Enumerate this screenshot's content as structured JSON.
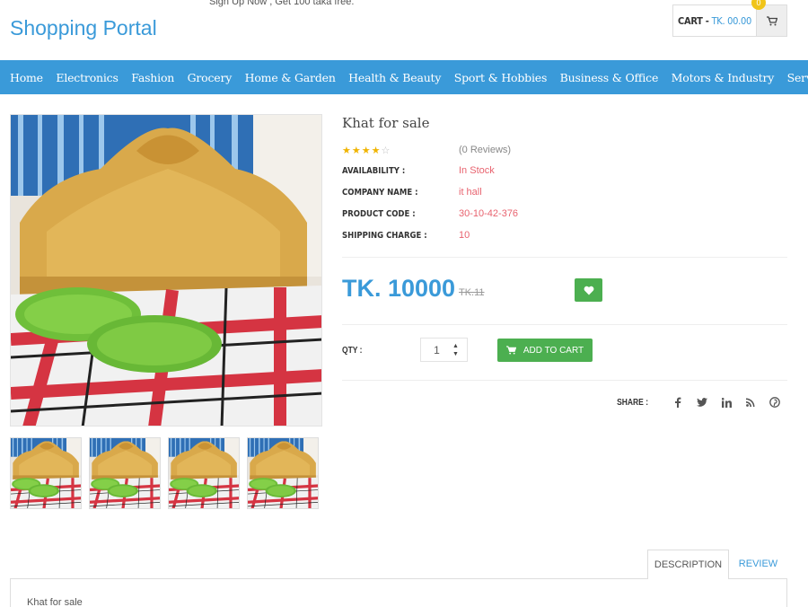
{
  "header": {
    "signup_note": "Sign Up Now , Get 100 taka free.",
    "logo": "Shopping Portal",
    "cart_label": "CART -",
    "cart_amount": "TK. 00.00",
    "cart_count": "0"
  },
  "nav": {
    "items": [
      "Home",
      "Electronics",
      "Fashion",
      "Grocery",
      "Home & Garden",
      "Health & Beauty",
      "Sport & Hobbies",
      "Business & Office",
      "Motors & Industry",
      "Services"
    ]
  },
  "product": {
    "title": "Khat for sale",
    "rating": 4,
    "rating_max": 5,
    "reviews": "(0 Reviews)",
    "specs": [
      {
        "label": "AVAILABILITY :",
        "value": "In Stock"
      },
      {
        "label": "COMPANY NAME :",
        "value": "it hall"
      },
      {
        "label": "PRODUCT CODE :",
        "value": "30-10-42-376"
      },
      {
        "label": "SHIPPING CHARGE :",
        "value": "10"
      }
    ],
    "price": "TK. 10000",
    "old_price": "TK.11",
    "qty_label": "QTY :",
    "qty_value": "1",
    "add_to_cart": "ADD TO CART",
    "share_label": "SHARE :",
    "share_icons": [
      "facebook-icon",
      "twitter-icon",
      "linkedin-icon",
      "rss-icon",
      "pinterest-icon"
    ]
  },
  "tabs": {
    "description": "DESCRIPTION",
    "review": "REVIEW",
    "description_text": "Khat for sale"
  },
  "colors": {
    "brand": "#3a9ad9",
    "green": "#4caf50",
    "spec_value": "#e8636f",
    "star": "#f0b400",
    "badge": "#f0c419"
  }
}
